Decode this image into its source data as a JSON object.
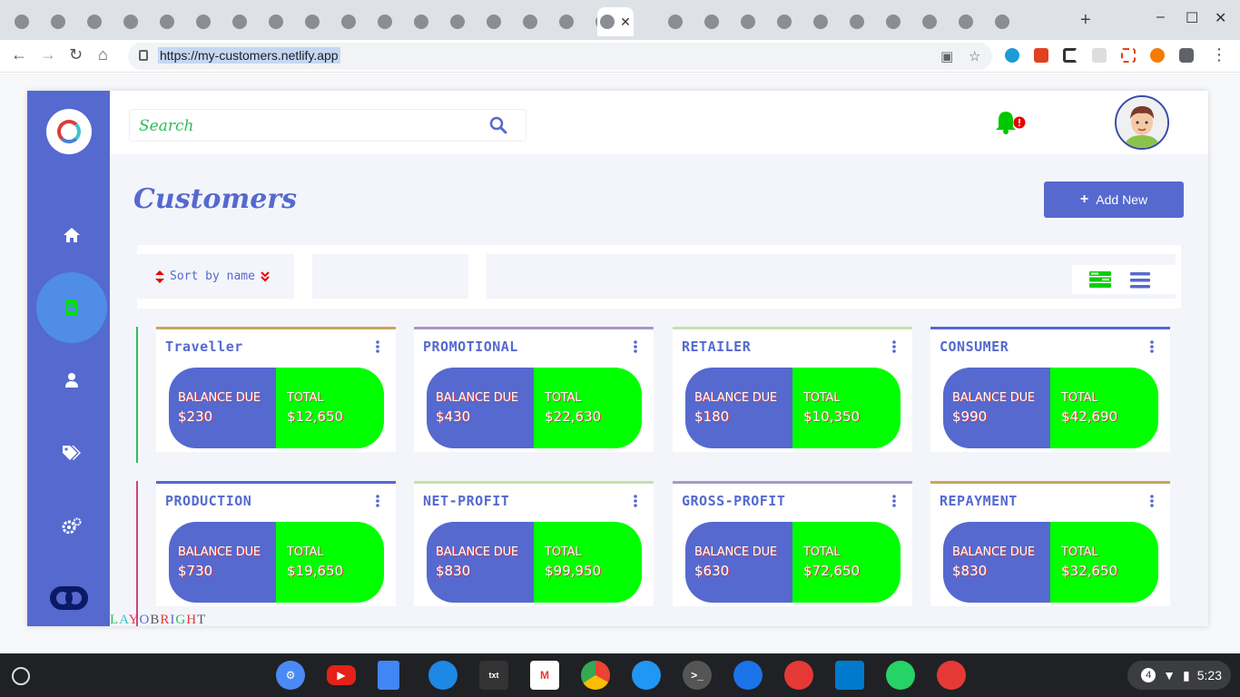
{
  "browser": {
    "url": "https://my-customers.netlify.app",
    "tab_icons": [
      "linkedin",
      "briefcase",
      "figma",
      "globe",
      "github",
      "globe",
      "globe",
      "react",
      "mz",
      "globe",
      "globe",
      "globe",
      "globe",
      "globe",
      "globe",
      "globe",
      "globe",
      "globe",
      "youtube",
      "code",
      "github",
      "diamond",
      "globe",
      "github",
      "globe",
      "twitter",
      "facebook"
    ]
  },
  "app": {
    "search_placeholder": "Search",
    "page_title": "Customers",
    "add_button_label": "Add New",
    "sort_label": "Sort by name",
    "brand_letters": [
      "L",
      "A",
      "Y",
      "O",
      "B",
      "R",
      "I",
      "G",
      "H",
      "T"
    ],
    "brand_colors": [
      "#2fbd5c",
      "#3ec3d1",
      "#e03a3a",
      "#5569cf",
      "#555555",
      "#e03a3a",
      "#5569cf",
      "#2fbd5c",
      "#e03a3a",
      "#555555"
    ]
  },
  "cards": [
    {
      "title": "Traveller",
      "border": "#c9a55a",
      "balance_label": "BALANCE DUE",
      "balance": "$230",
      "total_label": "TOTAL",
      "total": "$12,650"
    },
    {
      "title": "PROMOTIONAL",
      "border": "#a998c9",
      "balance_label": "BALANCE DUE",
      "balance": "$430",
      "total_label": "TOTAL",
      "total": "$22,630"
    },
    {
      "title": "RETAILER",
      "border": "#c6e0a8",
      "balance_label": "BALANCE DUE",
      "balance": "$180",
      "total_label": "TOTAL",
      "total": "$10,350"
    },
    {
      "title": "CONSUMER",
      "border": "#5569cf",
      "balance_label": "BALANCE DUE",
      "balance": "$990",
      "total_label": "TOTAL",
      "total": "$42,690"
    },
    {
      "title": "PRODUCTION",
      "border": "#5569cf",
      "balance_label": "BALANCE DUE",
      "balance": "$730",
      "total_label": "TOTAL",
      "total": "$19,650"
    },
    {
      "title": "NET-PROFIT",
      "border": "#c6e0a8",
      "balance_label": "BALANCE DUE",
      "balance": "$830",
      "total_label": "TOTAL",
      "total": "$99,950"
    },
    {
      "title": "GROSS-PROFIT",
      "border": "#a998c9",
      "balance_label": "BALANCE DUE",
      "balance": "$630",
      "total_label": "TOTAL",
      "total": "$72,650"
    },
    {
      "title": "REPAYMENT",
      "border": "#c9a55a",
      "balance_label": "BALANCE DUE",
      "balance": "$830",
      "total_label": "TOTAL",
      "total": "$32,650"
    }
  ],
  "shelf": {
    "tray_badge": "4",
    "time": "5:23"
  }
}
